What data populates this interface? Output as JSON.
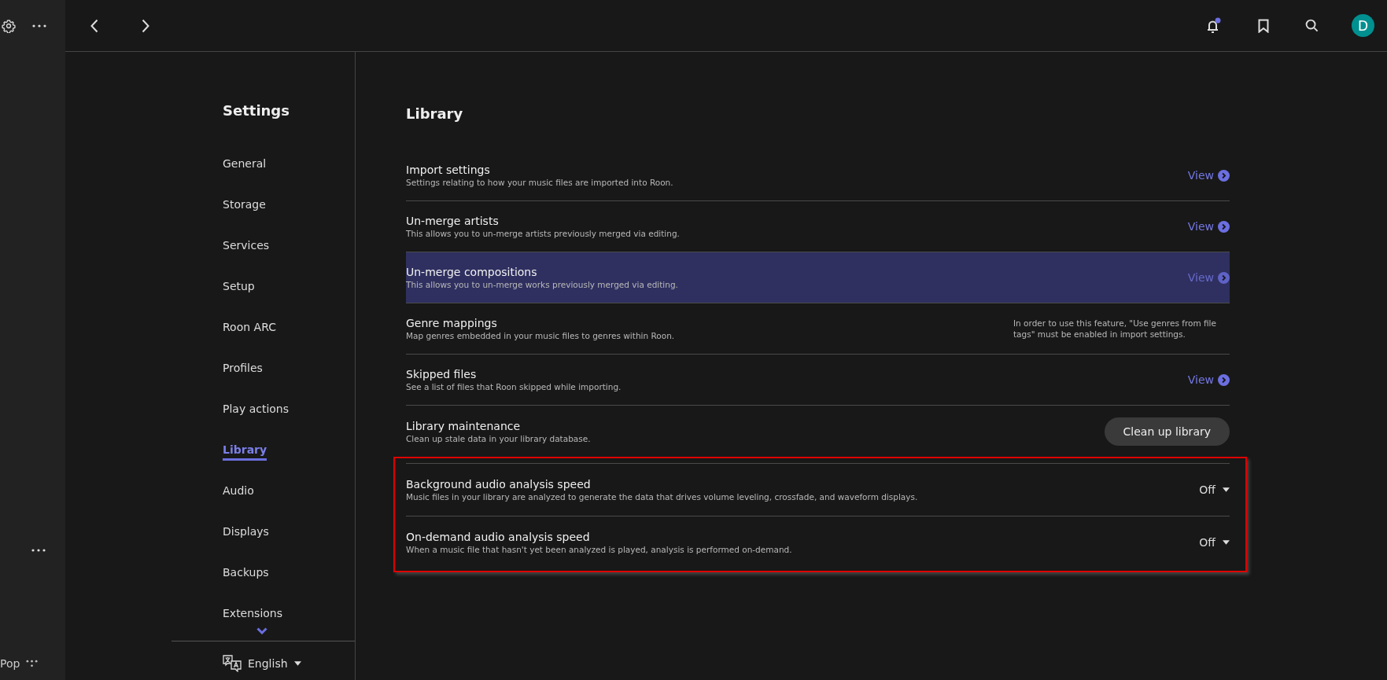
{
  "rail": {
    "bottom_label": "Pop"
  },
  "settings_nav": {
    "title": "Settings",
    "items": [
      {
        "label": "General",
        "selected": false
      },
      {
        "label": "Storage",
        "selected": false
      },
      {
        "label": "Services",
        "selected": false
      },
      {
        "label": "Setup",
        "selected": false
      },
      {
        "label": "Roon ARC",
        "selected": false
      },
      {
        "label": "Profiles",
        "selected": false
      },
      {
        "label": "Play actions",
        "selected": false
      },
      {
        "label": "Library",
        "selected": true
      },
      {
        "label": "Audio",
        "selected": false
      },
      {
        "label": "Displays",
        "selected": false
      },
      {
        "label": "Backups",
        "selected": false
      },
      {
        "label": "Extensions",
        "selected": false
      }
    ],
    "language": "English"
  },
  "top_bar": {
    "notification_unread": true,
    "avatar_letter": "D"
  },
  "page": {
    "title": "Library",
    "rows": [
      {
        "kind": "link",
        "title": "Import settings",
        "description": "Settings relating to how your music files are imported into Roon.",
        "action": "View",
        "highlighted": false
      },
      {
        "kind": "link",
        "title": "Un-merge artists",
        "description": "This allows you to un-merge artists previously merged via editing.",
        "action": "View",
        "highlighted": false
      },
      {
        "kind": "link",
        "title": "Un-merge compositions",
        "description": "This allows you to un-merge works previously merged via editing.",
        "action": "View",
        "highlighted": true
      },
      {
        "kind": "note",
        "title": "Genre mappings",
        "description": "Map genres embedded in your music files to genres within Roon.",
        "action": "In order to use this feature, \"Use genres from file tags\" must be enabled in import settings.",
        "highlighted": false
      },
      {
        "kind": "link",
        "title": "Skipped files",
        "description": "See a list of files that Roon skipped while importing.",
        "action": "View",
        "highlighted": false
      },
      {
        "kind": "button",
        "title": "Library maintenance",
        "description": "Clean up stale data in your library database.",
        "action": "Clean up library",
        "highlighted": false
      }
    ],
    "outlined_rows": [
      {
        "kind": "dropdown",
        "title": "Background audio analysis speed",
        "description": "Music files in your library are analyzed to generate the data that drives volume leveling, crossfade, and waveform displays.",
        "action": "Off",
        "highlighted": false
      },
      {
        "kind": "dropdown",
        "title": "On-demand audio analysis speed",
        "description": "When a music file that hasn't yet been analyzed is played, analysis is performed on-demand.",
        "action": "Off",
        "highlighted": false
      }
    ]
  }
}
